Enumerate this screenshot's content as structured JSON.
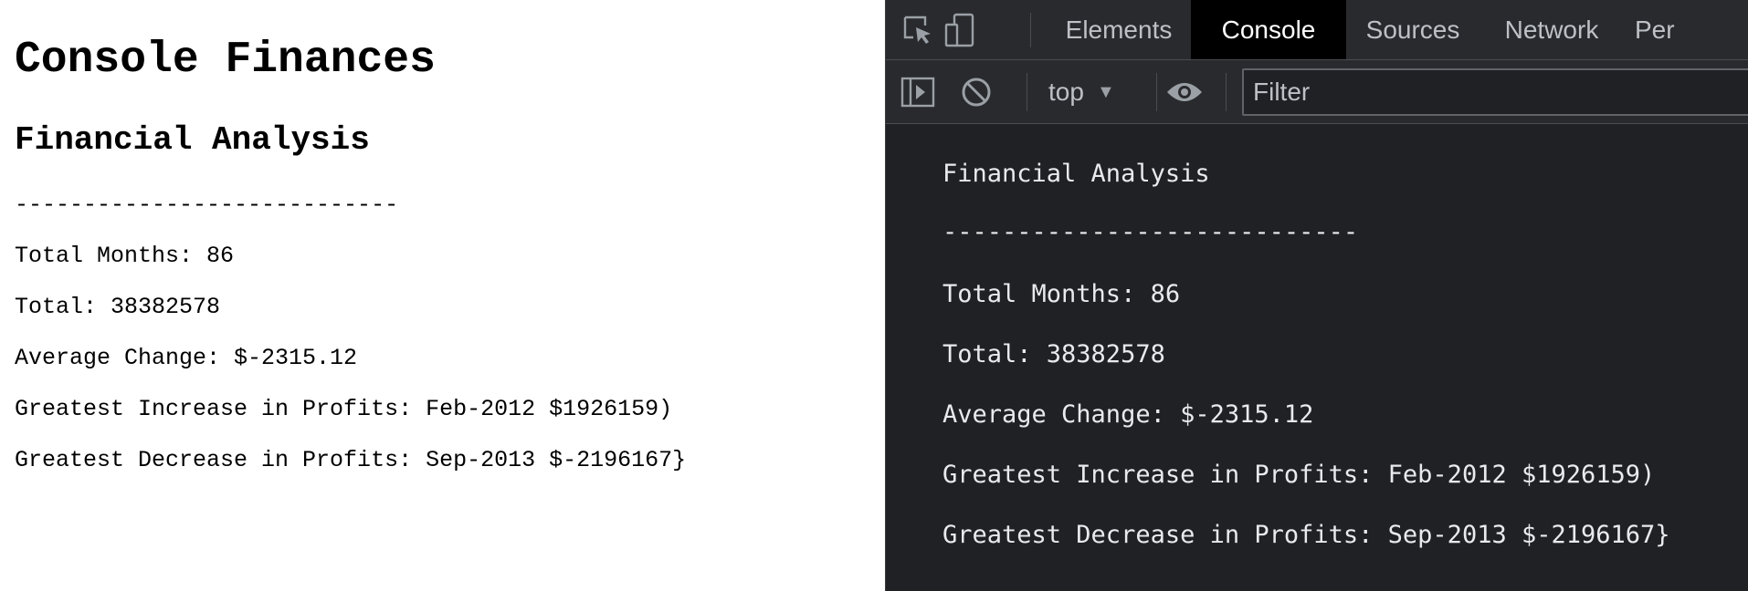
{
  "page": {
    "title": "Console Finances",
    "subtitle": "Financial Analysis",
    "separator": "----------------------------",
    "lines": [
      "Total Months: 86",
      "Total: 38382578",
      "Average Change: $-2315.12",
      "Greatest Increase in Profits: Feb-2012 $1926159)",
      "Greatest Decrease in Profits: Sep-2013 $-2196167}"
    ]
  },
  "devtools": {
    "tabs": [
      "Elements",
      "Console",
      "Sources",
      "Network",
      "Per"
    ],
    "active_tab": "Console",
    "toolbar": {
      "context": "top",
      "filter_placeholder": "Filter"
    },
    "console": {
      "messages": [
        "Financial Analysis",
        "----------------------------",
        "Total Months: 86",
        "Total: 38382578",
        "Average Change: $-2315.12",
        "Greatest Increase in Profits: Feb-2012 $1926159)",
        "Greatest Decrease in Profits: Sep-2013 $-2196167}"
      ]
    },
    "icons": {
      "inspect": "inspect-element-icon",
      "device": "device-toggle-icon",
      "sidebar": "show-sidebar-icon",
      "clear": "clear-console-icon",
      "eye": "live-expression-eye-icon"
    },
    "colors": {
      "background": "#202124",
      "toolbar": "#292a2d",
      "text": "#e8eaed",
      "tab_text": "#bdc1c6",
      "active_tab_bg": "#000000",
      "icon": "#9aa0a6"
    }
  }
}
